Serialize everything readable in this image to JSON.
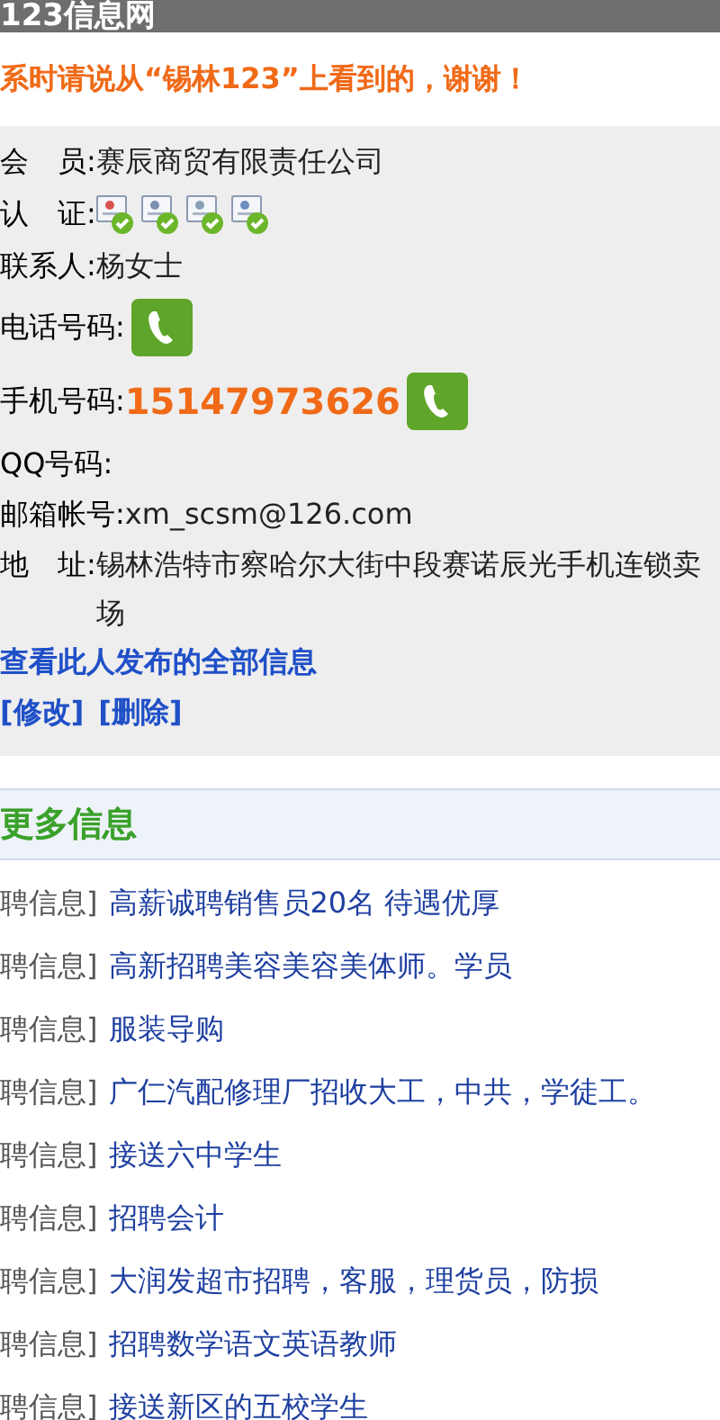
{
  "header": {
    "title": "123信息网"
  },
  "notice": "系时请说从“锡林123”上看到的，谢谢！",
  "fields": [
    {
      "kind": "text",
      "label": "会　员:",
      "value": "赛辰商贸有限责任公司"
    },
    {
      "kind": "badges",
      "label": "认　证:"
    },
    {
      "kind": "text",
      "label": "联系人:",
      "value": "杨女士"
    },
    {
      "kind": "phone",
      "label": "电话号码:"
    },
    {
      "kind": "mobile",
      "label": "手机号码:",
      "value": "15147973626"
    },
    {
      "kind": "text",
      "label": "QQ号码:"
    },
    {
      "kind": "text",
      "label": "邮箱帐号:",
      "value": "xm_scsm@126.com"
    },
    {
      "kind": "text",
      "label": "地　址:",
      "value": "锡林浩特市察哈尔大街中段赛诺辰光手机连锁卖场"
    }
  ],
  "all_posts_link": "查看此人发布的全部信息",
  "actions": [
    "[修改]",
    "[删除]"
  ],
  "more": {
    "title": "更多信息",
    "items": [
      {
        "category": "聘信息]",
        "title": "高薪诚聘销售员20名 待遇优厚"
      },
      {
        "category": "聘信息]",
        "title": "高新招聘美容美容美体师。学员"
      },
      {
        "category": "聘信息]",
        "title": "服装导购"
      },
      {
        "category": "聘信息]",
        "title": "广仁汽配修理厂招收大工，中共，学徒工。"
      },
      {
        "category": "聘信息]",
        "title": "接送六中学生"
      },
      {
        "category": "聘信息]",
        "title": "招聘会计"
      },
      {
        "category": "聘信息]",
        "title": "大润发超市招聘，客服，理货员，防损"
      },
      {
        "category": "聘信息]",
        "title": "招聘数学语文英语教师"
      },
      {
        "category": "聘信息]",
        "title": "接送新区的五校学生"
      }
    ]
  }
}
